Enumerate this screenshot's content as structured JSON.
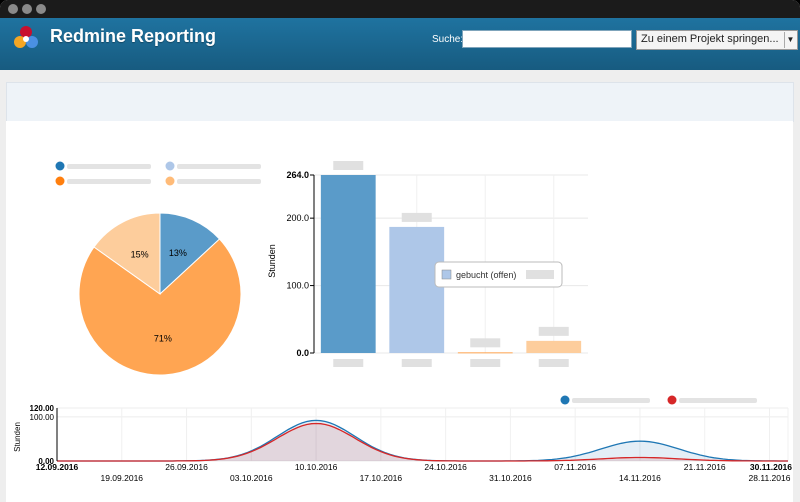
{
  "header": {
    "title": "Redmine Reporting",
    "search_label": "Suche:",
    "search_value": "",
    "project_select": "Zu einem Projekt springen..."
  },
  "colors": {
    "header": "#1f73a0",
    "dark_blue": "#5a9bc9",
    "light_blue": "#aec7e8",
    "orange": "#ffa552",
    "light_orange": "#fdcd9c",
    "red": "#d62728"
  },
  "chart_data": [
    {
      "type": "pie",
      "slices": [
        {
          "label": "13%",
          "value": 13,
          "color": "#5a9bc9"
        },
        {
          "label": "71%",
          "value": 71,
          "color": "#ffa552"
        },
        {
          "label": "15%",
          "value": 15,
          "color": "#fdcd9c"
        }
      ]
    },
    {
      "type": "bar",
      "ylabel": "Stunden",
      "ylim": [
        0,
        264
      ],
      "yticks": [
        "0.0",
        "100.0",
        "200.0",
        "264.0"
      ],
      "ytick_values": [
        0,
        100,
        200,
        264
      ],
      "values": [
        264,
        187,
        1,
        18
      ],
      "colors": [
        "#5a9bc9",
        "#aec7e8",
        "#ffa552",
        "#fdcd9c"
      ],
      "tooltip": "gebucht (offen)"
    },
    {
      "type": "area",
      "ylabel": "Stunden",
      "ylim": [
        0,
        120
      ],
      "yticks": [
        "0.00",
        "100.00",
        "120.00"
      ],
      "ytick_values": [
        0,
        100,
        120
      ],
      "xlim": [
        "2016-09-12",
        "2016-11-30"
      ],
      "xticks": [
        "12.09.2016",
        "19.09.2016",
        "26.09.2016",
        "03.10.2016",
        "10.10.2016",
        "17.10.2016",
        "24.10.2016",
        "31.10.2016",
        "07.11.2016",
        "14.11.2016",
        "21.11.2016",
        "28.11.2016",
        "30.11.2016"
      ],
      "bold_xticks": [
        "12.09.2016",
        "30.11.2016"
      ],
      "series": [
        {
          "color": "#1f77b4",
          "peaks": [
            {
              "x": "2016-10-10",
              "y": 92
            },
            {
              "x": "2016-11-14",
              "y": 45
            }
          ]
        },
        {
          "color": "#d62728",
          "peaks": [
            {
              "x": "2016-10-10",
              "y": 85
            },
            {
              "x": "2016-11-14",
              "y": 8
            }
          ]
        }
      ]
    }
  ]
}
